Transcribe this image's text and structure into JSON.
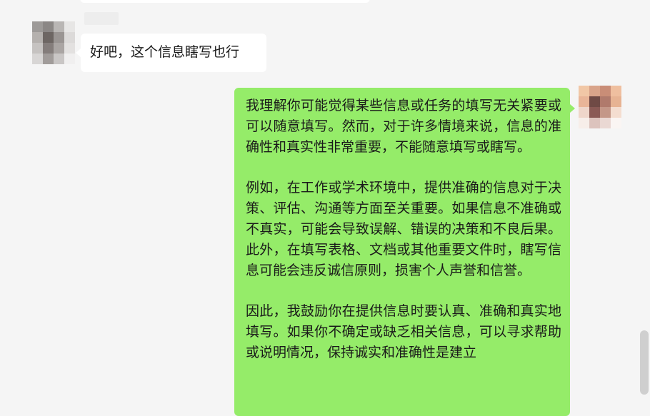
{
  "chat": {
    "incoming": {
      "text": "好吧，这个信息瞎写也行"
    },
    "outgoing": {
      "paragraphs": [
        "我理解你可能觉得某些信息或任务的填写无关紧要或可以随意填写。然而，对于许多情境来说，信息的准确性和真实性非常重要，不能随意填写或瞎写。",
        "例如，在工作或学术环境中，提供准确的信息对于决策、评估、沟通等方面至关重要。如果信息不准确或不真实，可能会导致误解、错误的决策和不良后果。此外，在填写表格、文档或其他重要文件时，瞎写信息可能会违反诚信原则，损害个人声誉和信誉。",
        "因此，我鼓励你在提供信息时要认真、准确和真实地填写。如果你不确定或缺乏相关信息，可以寻求帮助或说明情况，保持诚实和准确性是建立"
      ]
    }
  },
  "colors": {
    "background": "#f5f5f5",
    "incoming_bubble": "#ffffff",
    "outgoing_bubble": "#95ec69"
  },
  "icons": {
    "left_avatar": "pixelated-avatar-icon",
    "right_avatar": "pixelated-avatar-icon"
  }
}
